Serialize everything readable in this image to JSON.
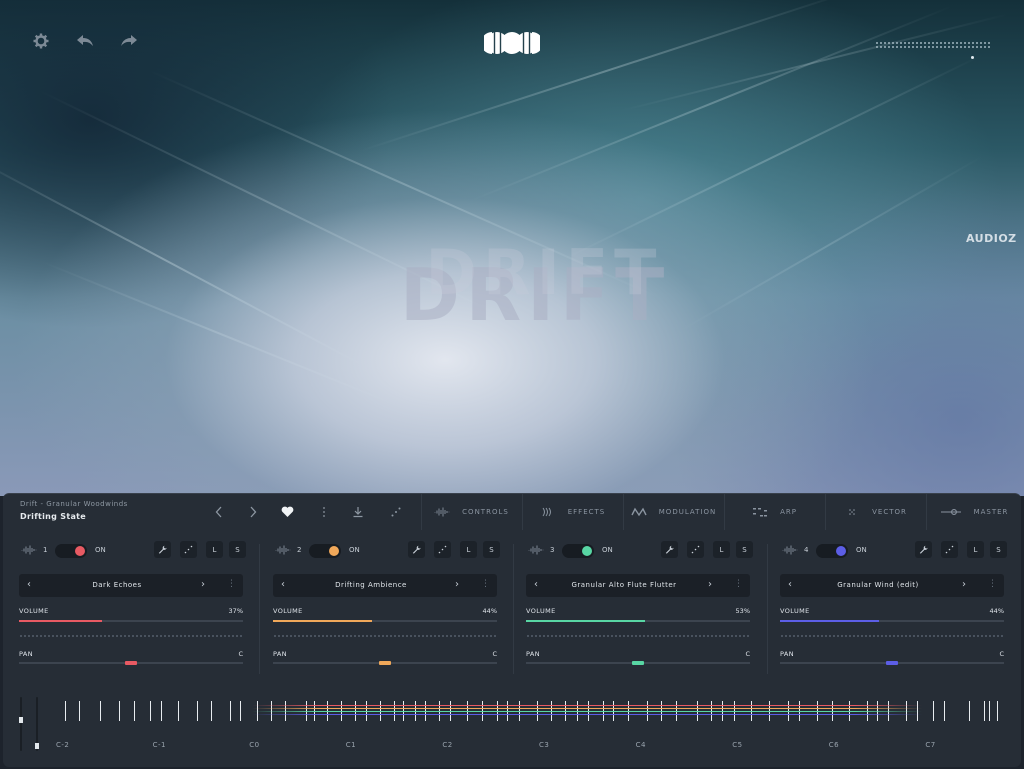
{
  "preset": {
    "path": "Drift - Granular Woodwinds",
    "name": "Drifting State"
  },
  "hero": {
    "logo_text": "DRIFT"
  },
  "tabs": [
    {
      "label": "CONTROLS",
      "icon": "waveform-icon"
    },
    {
      "label": "EFFECTS",
      "icon": "signal-icon"
    },
    {
      "label": "MODULATION",
      "icon": "modulation-icon"
    },
    {
      "label": "ARP",
      "icon": "arp-icon"
    },
    {
      "label": "VECTOR",
      "icon": "vector-icon"
    },
    {
      "label": "MASTER",
      "icon": "slider-icon"
    }
  ],
  "layers": [
    {
      "num": "1",
      "state": "ON",
      "preset": "Dark Echoes",
      "volume_label": "VOLUME",
      "volume": "37%",
      "volume_fraction": 0.37,
      "pan_label": "PAN",
      "pan": "C",
      "color": "#e85a63",
      "lock_label": "L",
      "solo_label": "S"
    },
    {
      "num": "2",
      "state": "ON",
      "preset": "Drifting Ambience",
      "volume_label": "VOLUME",
      "volume": "44%",
      "volume_fraction": 0.44,
      "pan_label": "PAN",
      "pan": "C",
      "color": "#f0a85a",
      "lock_label": "L",
      "solo_label": "S"
    },
    {
      "num": "3",
      "state": "ON",
      "preset": "Granular Alto Flute Flutter",
      "volume_label": "VOLUME",
      "volume": "53%",
      "volume_fraction": 0.53,
      "pan_label": "PAN",
      "pan": "C",
      "color": "#58d6a4",
      "lock_label": "L",
      "solo_label": "S"
    },
    {
      "num": "4",
      "state": "ON",
      "preset": "Granular Wind (edit)",
      "volume_label": "VOLUME",
      "volume": "44%",
      "volume_fraction": 0.44,
      "pan_label": "PAN",
      "pan": "C",
      "color": "#5c5ee6",
      "lock_label": "L",
      "solo_label": "S"
    }
  ],
  "keyboard": {
    "octaves": [
      "C-2",
      "C-1",
      "C0",
      "C1",
      "C2",
      "C3",
      "C4",
      "C5",
      "C6",
      "C7"
    ]
  },
  "watermark": "AUDIOZ"
}
